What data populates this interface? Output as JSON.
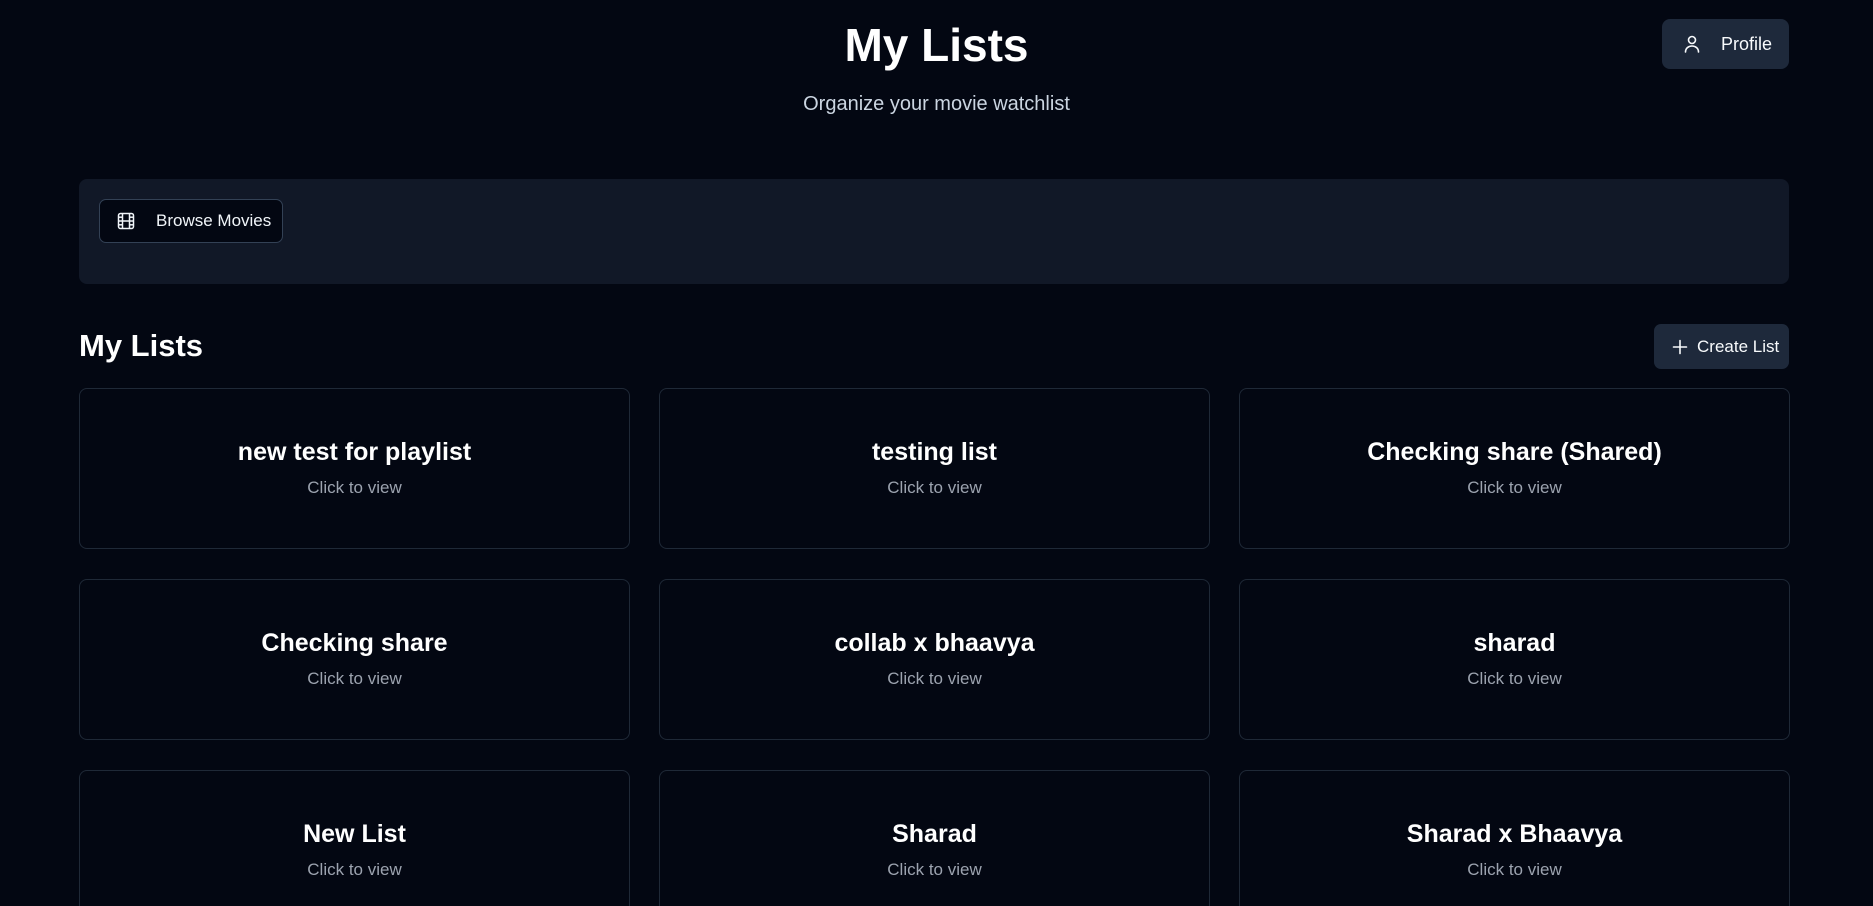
{
  "header": {
    "title": "My Lists",
    "subtitle": "Organize your movie watchlist",
    "profile_label": "Profile",
    "profile_icon": "user-icon"
  },
  "toolbar": {
    "browse_label": "Browse Movies",
    "browse_icon": "film-icon"
  },
  "section": {
    "title": "My Lists",
    "create_label": "Create List",
    "create_icon": "plus-icon"
  },
  "lists": [
    {
      "title": "new test for playlist",
      "subtitle": "Click to view"
    },
    {
      "title": "testing list",
      "subtitle": "Click to view"
    },
    {
      "title": "Checking share (Shared)",
      "subtitle": "Click to view"
    },
    {
      "title": "Checking share",
      "subtitle": "Click to view"
    },
    {
      "title": "collab x bhaavya",
      "subtitle": "Click to view"
    },
    {
      "title": "sharad",
      "subtitle": "Click to view"
    },
    {
      "title": "New List",
      "subtitle": "Click to view"
    },
    {
      "title": "Sharad",
      "subtitle": "Click to view"
    },
    {
      "title": "Sharad x Bhaavya",
      "subtitle": "Click to view"
    }
  ],
  "colors": {
    "background": "#030712",
    "panel": "#111827",
    "button": "#1e293b",
    "card_border": "#1f2937",
    "muted_text": "#9ca3af"
  }
}
